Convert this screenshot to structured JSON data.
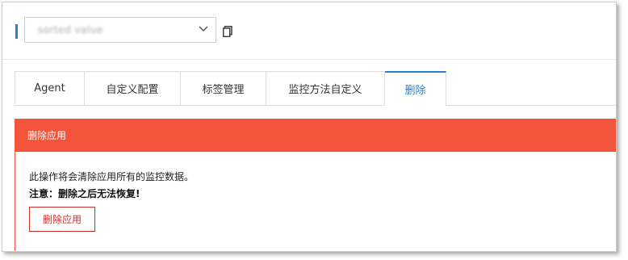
{
  "header": {
    "app_selector_value": "sorted value"
  },
  "tabs": [
    {
      "label": "Agent",
      "active": false
    },
    {
      "label": "自定义配置",
      "active": false
    },
    {
      "label": "标签管理",
      "active": false
    },
    {
      "label": "监控方法自定义",
      "active": false
    },
    {
      "label": "删除",
      "active": true
    }
  ],
  "delete_panel": {
    "title": "删除应用",
    "description": "此操作将会清除应用所有的监控数据。",
    "warning": "注意：删除之后无法恢复!",
    "button_label": "删除应用"
  },
  "colors": {
    "accent": "#2a7ed2",
    "danger": "#f4553a",
    "danger_text": "#c9302c"
  },
  "icons": {
    "select_arrow": "chevron-down-icon",
    "copy": "copy-icon"
  }
}
